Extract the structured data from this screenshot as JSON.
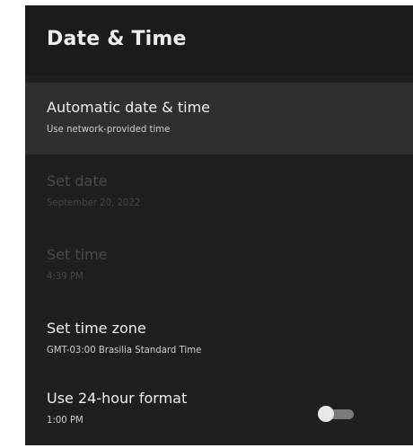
{
  "header": {
    "title": "Date & Time"
  },
  "settings": [
    {
      "title": "Automatic date & time",
      "subtitle": "Use network-provided time",
      "state": "focused"
    },
    {
      "title": "Set date",
      "subtitle": "September 20, 2022",
      "state": "disabled"
    },
    {
      "title": "Set time",
      "subtitle": "4:39 PM",
      "state": "disabled"
    },
    {
      "title": "Set time zone",
      "subtitle": "GMT-03:00 Brasilia Standard Time",
      "state": "enabled"
    },
    {
      "title": "Use 24-hour format",
      "subtitle": "1:00 PM",
      "state": "enabled",
      "toggle_on": false
    }
  ],
  "colors": {
    "panel_background": "#1f1f1f",
    "header_background": "#1b1b1b",
    "focused_row_background": "#2f2f2f",
    "text_primary": "#f0f0f0",
    "text_disabled": "#4a4a4a"
  }
}
